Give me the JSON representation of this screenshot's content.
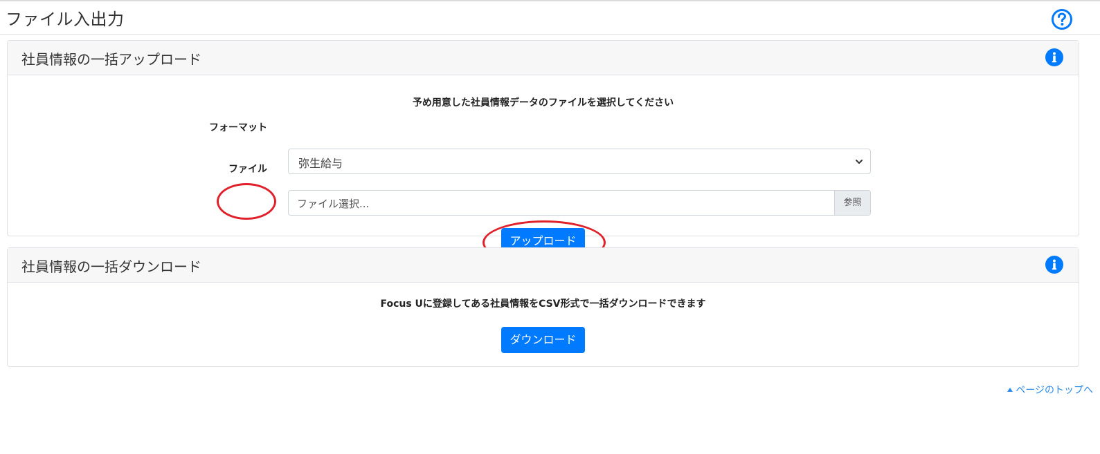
{
  "page": {
    "title": "ファイル入出力",
    "help_icon": "question-circle-icon",
    "accent_color": "#007bff",
    "highlight_color": "#e0202a"
  },
  "upload_card": {
    "title": "社員情報の一括アップロード",
    "info_icon": "info-circle-icon",
    "instruction": "予め用意した社員情報データのファイルを選択してください",
    "format_label": "フォーマット",
    "format_selected": "弥生給与",
    "file_label": "ファイル",
    "file_placeholder": "ファイル選択...",
    "browse_label": "参照",
    "upload_button": "アップロード"
  },
  "download_card": {
    "title": "社員情報の一括ダウンロード",
    "info_icon": "info-circle-icon",
    "instruction": "Focus Uに登録してある社員情報をCSV形式で一括ダウンロードできます",
    "download_button": "ダウンロード"
  },
  "footer": {
    "back_to_top": "ページのトップへ"
  }
}
